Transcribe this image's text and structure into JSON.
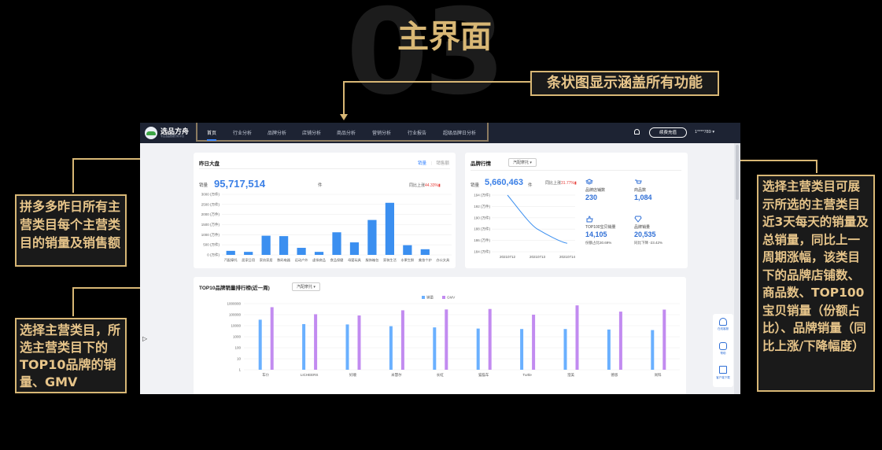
{
  "slide": {
    "bg_number": "03",
    "title": "主界面",
    "annotations": {
      "top": "条状图显示涵盖所有功能",
      "left1": "拼多多昨日所有主营类目每个主营类目的销量及销售额",
      "left2": "选择主营类目，所选主营类目下的TOP10品牌的销量、GMV",
      "right": "选择主营类目可展示所选的主营类目近3天每天的销量及总销量，同比上一周期涨幅，该类目下的品牌店铺数、商品数、TOP100宝贝销量（份额占比）、品牌销量（同比上涨/下降幅度）"
    }
  },
  "app": {
    "brand": "选品方舟",
    "brand_sub": "专业选品数据分析平台",
    "nav": [
      "首页",
      "行业分析",
      "品牌分析",
      "店铺分析",
      "商品分析",
      "营销分析",
      "行业报告",
      "超级品牌日分析"
    ],
    "renew": "续费充值",
    "user": "1****789 ▾",
    "side_tools": [
      "在线客服",
      "帮助",
      "客户端下载"
    ]
  },
  "yesterday": {
    "title": "昨日大盘",
    "tabs": [
      "销量",
      "销售额"
    ],
    "metric_label": "销量",
    "value": "95,717,514",
    "unit": "件",
    "compare_label": "同比上涨",
    "compare_value": "44.33%"
  },
  "brand_trend": {
    "title": "品牌行情",
    "select": "汽配摩托",
    "metric_label": "销量",
    "value": "5,660,463",
    "unit": "件",
    "compare_label": "同比上涨",
    "compare_value": "31.77%",
    "stats": {
      "store_label": "品牌店铺数",
      "store_value": "230",
      "goods_label": "商品数",
      "goods_value": "1,084",
      "top100_label": "TOP100宝贝销量",
      "top100_value": "14,105",
      "top100_sub": "份额占比30.69%",
      "brand_sales_label": "品牌销量",
      "brand_sales_value": "20,535",
      "brand_sales_sub": "同比下降 -23.42%"
    }
  },
  "top10": {
    "title": "TOP10品牌销量排行榜(近一周)",
    "select": "汽配摩托"
  },
  "chart_data": [
    {
      "type": "bar",
      "title": "",
      "ylabel": "",
      "categories": [
        "汽配摩托",
        "居家日用",
        "家纺家居",
        "数码电器",
        "运动户外",
        "虚拟商品",
        "食品保健",
        "母婴玩具",
        "服饰箱包",
        "家装生活",
        "水果生鲜",
        "美妆个护",
        "办公文具"
      ],
      "category_labels_shown": [
        "汽配摩托",
        "家纺家居",
        "运动户外",
        "食品保健",
        "服饰箱包",
        "水果生鲜",
        "美妆个护",
        "办公文具"
      ],
      "values": [
        200,
        150,
        950,
        930,
        350,
        150,
        1120,
        620,
        1730,
        2580,
        480,
        280
      ],
      "unit": "(万件)",
      "yticks": [
        "0 (万件)",
        "500 (万件)",
        "1000 (万件)",
        "1500 (万件)",
        "2000 (万件)",
        "2500 (万件)",
        "3000 (万件)"
      ],
      "ylim": [
        0,
        3000
      ]
    },
    {
      "type": "line",
      "title": "",
      "categories": [
        "20210712",
        "20210713",
        "20210714"
      ],
      "values": [
        194,
        188,
        185.5
      ],
      "unit": "(万件)",
      "yticks": [
        "184 (万件)",
        "186 (万件)",
        "188 (万件)",
        "190 (万件)",
        "192 (万件)",
        "194 (万件)"
      ],
      "ylim": [
        184,
        194
      ]
    },
    {
      "type": "bar",
      "title": "",
      "scale": "log",
      "categories": [
        "车仆",
        "LICHEERS",
        "好顺",
        "米慧尔",
        "长虹",
        "猫猫车",
        "Turtle",
        "澄美",
        "德恩",
        "尚科"
      ],
      "yticks": [
        "1",
        "10",
        "100",
        "1000",
        "10000",
        "100000",
        "1000000"
      ],
      "ylim": [
        1,
        1000000
      ],
      "series": [
        {
          "name": "销量",
          "color": "#6ab0ff",
          "values": [
            35000,
            14000,
            13000,
            9000,
            7000,
            5500,
            5000,
            5000,
            4500,
            4000
          ]
        },
        {
          "name": "GMV",
          "color": "#c28bf0",
          "values": [
            480000,
            110000,
            85000,
            250000,
            300000,
            330000,
            100000,
            700000,
            190000,
            290000
          ]
        }
      ]
    }
  ]
}
